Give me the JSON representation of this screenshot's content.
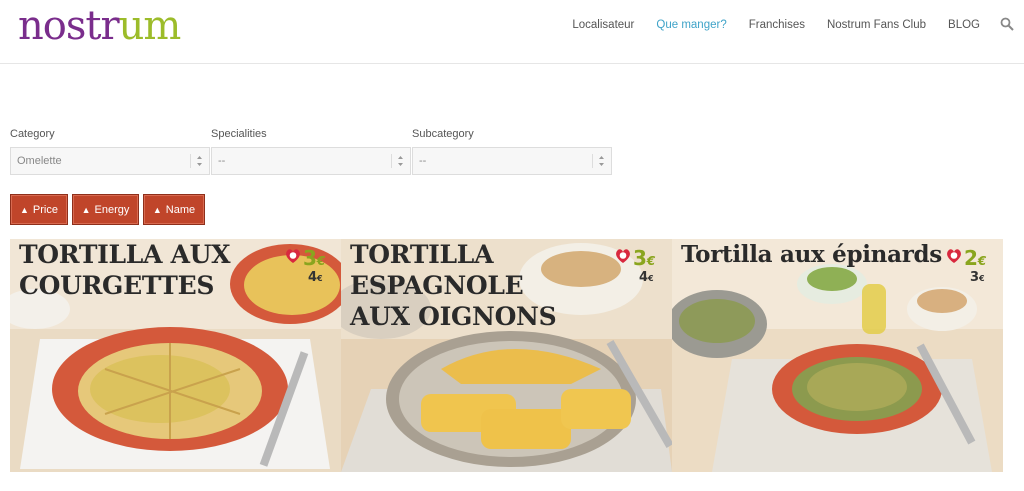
{
  "brand": {
    "part1": "nostr",
    "part2": "um",
    "color1": "#7a2d8c",
    "color2": "#9cbc2a"
  },
  "nav": {
    "items": [
      {
        "label": "Localisateur",
        "active": false
      },
      {
        "label": "Que manger?",
        "active": true
      },
      {
        "label": "Franchises",
        "active": false
      },
      {
        "label": "Nostrum Fans Club",
        "active": false
      },
      {
        "label": "BLOG",
        "active": false
      }
    ],
    "search_icon": "magnifier-icon",
    "active_color": "#3fa3c8"
  },
  "filters": [
    {
      "label": "Category",
      "value": "Omelette"
    },
    {
      "label": "Specialities",
      "value": "--"
    },
    {
      "label": "Subcategory",
      "value": "--"
    }
  ],
  "sort": {
    "buttons": [
      {
        "label": "Price",
        "icon": "triangle-up-icon"
      },
      {
        "label": "Energy",
        "icon": "triangle-up-icon"
      },
      {
        "label": "Name",
        "icon": "triangle-up-icon"
      }
    ],
    "color": "#c0452a"
  },
  "products": [
    {
      "name": "TORTILLA AUX COURGETTES",
      "price_main": "3",
      "price_alt": "4",
      "currency": "€"
    },
    {
      "name": "TORTILLA ESPAGNOLE AUX OIGNONS",
      "price_main": "3",
      "price_alt": "4",
      "currency": "€"
    },
    {
      "name": "Tortilla aux épinards",
      "price_main": "2",
      "price_alt": "3",
      "currency": "€"
    }
  ]
}
